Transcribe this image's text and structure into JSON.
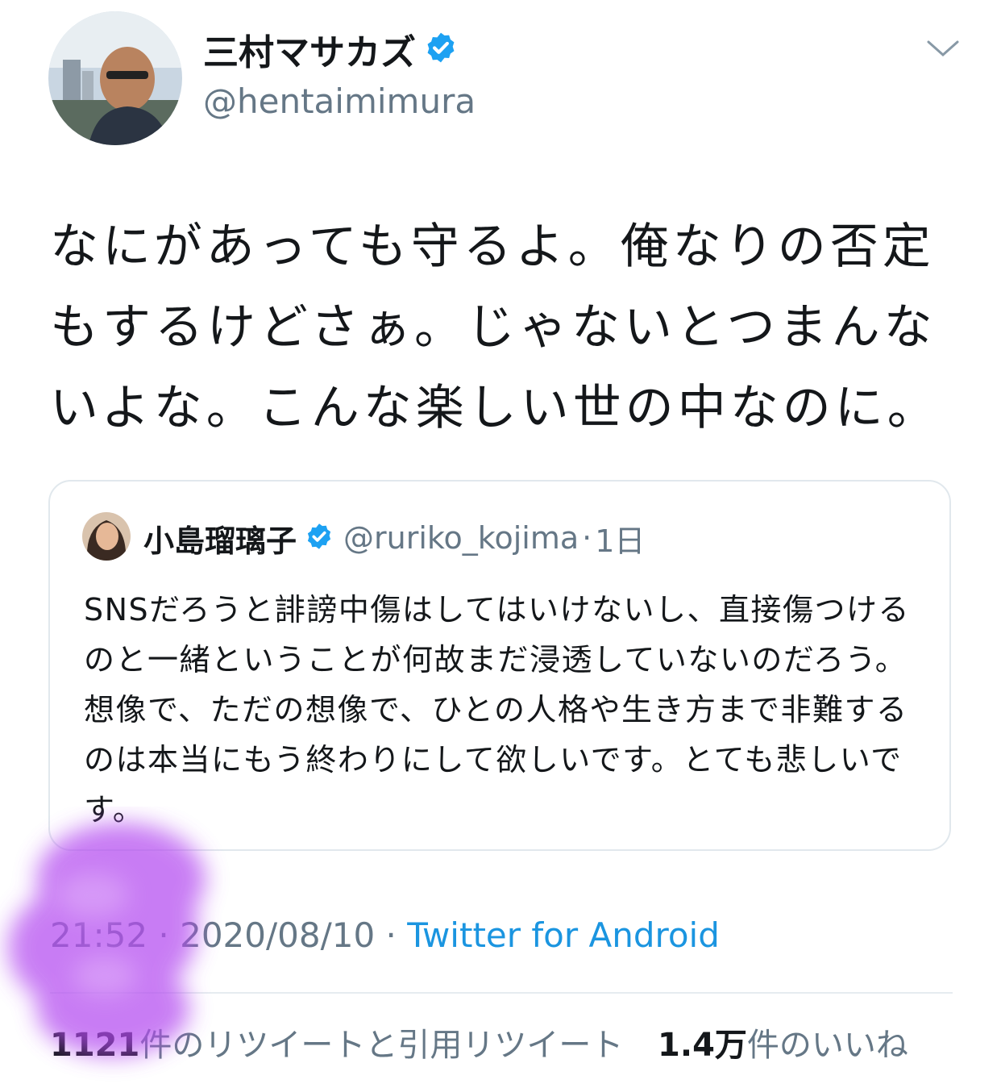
{
  "tweet": {
    "author_name": "三村マサカズ",
    "author_handle": "@hentaimimura",
    "body": "なにがあっても守るよ。俺なりの否定もするけどさぁ。じゃないとつまんないよな。こんな楽しい世の中なのに。",
    "time": "21:52",
    "date": "2020/08/10",
    "source": "Twitter for Android",
    "separator": " · "
  },
  "quote": {
    "author_name": "小島瑠璃子",
    "author_handle": "@ruriko_kojima",
    "age": "1日",
    "separator": "·",
    "body": "SNSだろうと誹謗中傷はしてはいけないし、直接傷つけるのと一緒ということが何故まだ浸透していないのだろう。想像で、ただの想像で、ひとの人格や生き方まで非難するのは本当にもう終わりにして欲しいです。とても悲しいです。"
  },
  "stats": {
    "retweet_count": "1121",
    "retweet_label": "件のリツイートと引用リツイート",
    "like_count": "1.4万",
    "like_label": "件のいいね"
  },
  "icons": {
    "verified": "verified-badge-icon",
    "menu": "chevron-down-icon"
  },
  "colors": {
    "verified_blue": "#1da1f2",
    "link_blue": "#1b95e0",
    "secondary_text": "#657786",
    "scribble_purple": "#b44cf0"
  }
}
